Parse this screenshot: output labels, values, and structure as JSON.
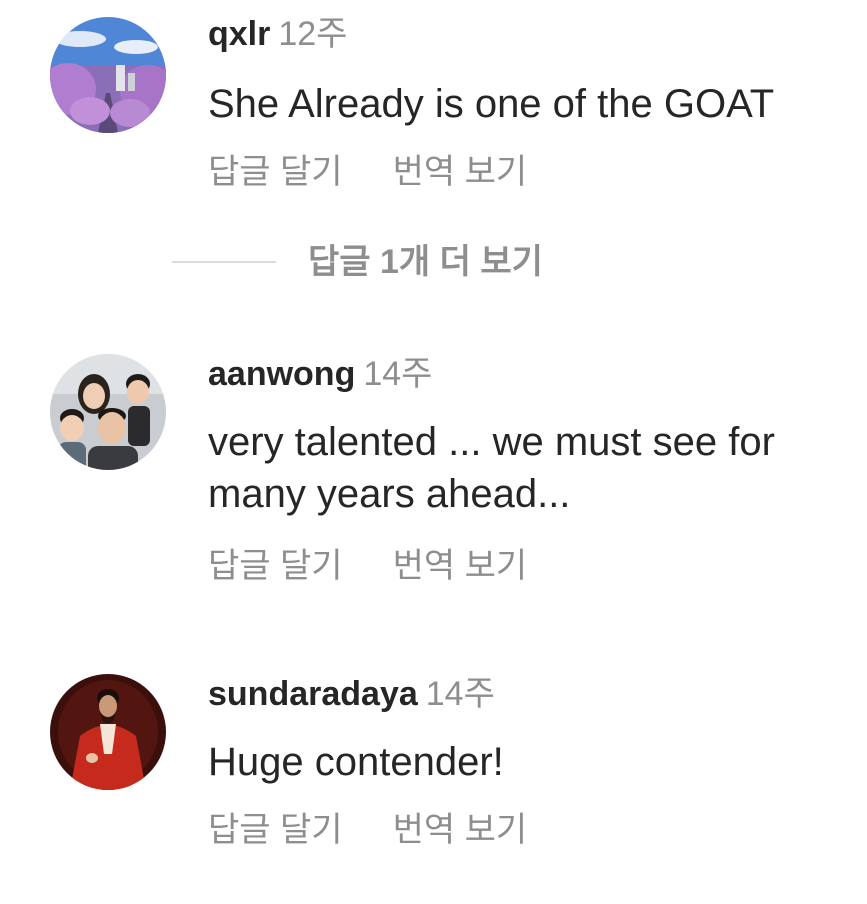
{
  "comments": [
    {
      "username": "qxlr",
      "time": "12주",
      "text": "She Already is one of the GOAT",
      "reply_label": "답글 달기",
      "translate_label": "번역 보기",
      "avatar": "avatar-cherry-blossom-street"
    },
    {
      "username": "aanwong",
      "time": "14주",
      "text": "very talented ... we must see for many years ahead...",
      "reply_label": "답글 달기",
      "translate_label": "번역 보기",
      "avatar": "avatar-family-photo"
    },
    {
      "username": "sundaradaya",
      "time": "14주",
      "text": "Huge contender!",
      "reply_label": "답글 달기",
      "translate_label": "번역 보기",
      "avatar": "avatar-painting-red-coat"
    }
  ],
  "more_replies": {
    "label": "답글 1개 더 보기"
  },
  "colors": {
    "primary_text": "#262626",
    "secondary_text": "#8e8e8e",
    "divider": "#dbdbdb"
  }
}
